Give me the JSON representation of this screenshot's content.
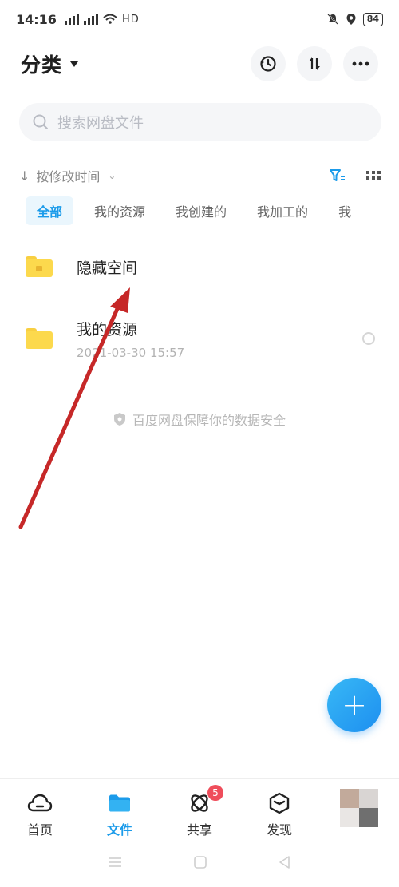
{
  "status_bar": {
    "time": "14:16",
    "network": "HD",
    "battery": "84"
  },
  "header": {
    "title": "分类"
  },
  "search": {
    "placeholder": "搜索网盘文件"
  },
  "sort": {
    "label": "按修改时间"
  },
  "tabs": [
    {
      "label": "全部",
      "active": true
    },
    {
      "label": "我的资源"
    },
    {
      "label": "我创建的"
    },
    {
      "label": "我加工的"
    },
    {
      "label": "我"
    }
  ],
  "files": [
    {
      "name": "隐藏空间"
    },
    {
      "name": "我的资源",
      "date": "2021-03-30  15:57"
    }
  ],
  "safety_notice": "百度网盘保障你的数据安全",
  "bottom_nav": [
    {
      "label": "首页",
      "icon": "cloud-home-icon"
    },
    {
      "label": "文件",
      "icon": "folder-icon",
      "active": true
    },
    {
      "label": "共享",
      "icon": "share-atom-icon",
      "badge": "5"
    },
    {
      "label": "发现",
      "icon": "cube-discover-icon"
    },
    {
      "icon": "avatar"
    }
  ],
  "colors": {
    "accent": "#1b9bea",
    "folder": "#fcd94d",
    "badge": "#ef4d5b",
    "annotation_arrow": "#c62828"
  }
}
